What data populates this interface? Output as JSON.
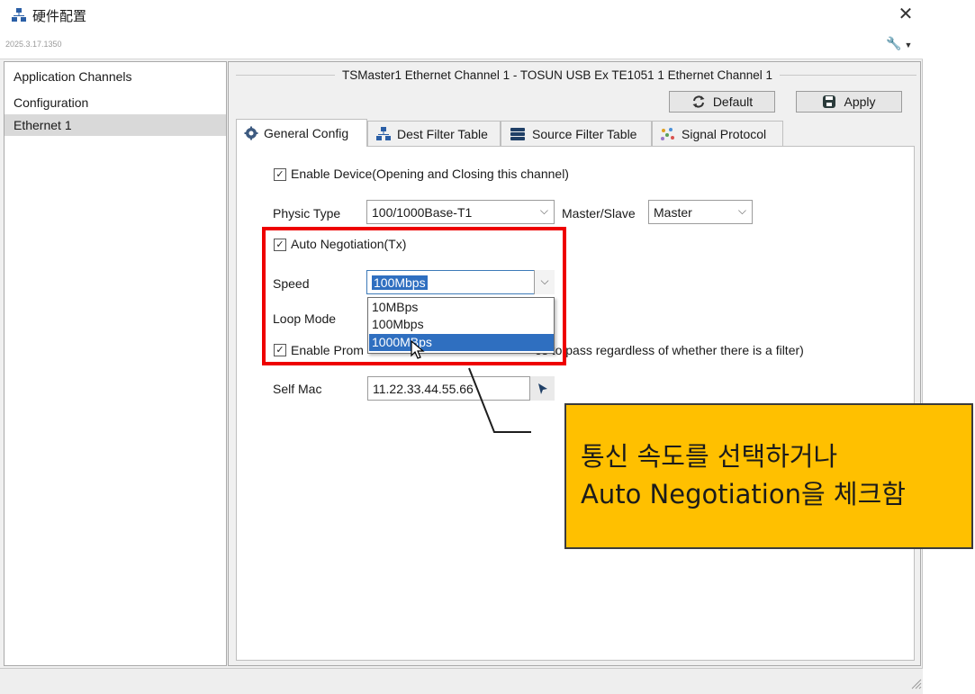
{
  "window": {
    "title": "硬件配置",
    "version": "2025.3.17.1350"
  },
  "tree": {
    "items": [
      "Application Channels",
      "Configuration",
      "Ethernet 1"
    ],
    "selected": "Ethernet 1"
  },
  "channel": {
    "title": "TSMaster1 Ethernet Channel 1 - TOSUN USB Ex TE1051 1 Ethernet Channel 1"
  },
  "toolbar": {
    "default_label": "Default",
    "apply_label": "Apply"
  },
  "tabs": [
    {
      "label": "General Config",
      "active": true
    },
    {
      "label": "Dest Filter Table",
      "active": false
    },
    {
      "label": "Source Filter Table",
      "active": false
    },
    {
      "label": "Signal Protocol",
      "active": false
    }
  ],
  "form": {
    "enable_device_label": "Enable Device(Opening and Closing this channel)",
    "enable_device_checked": true,
    "physic_type_label": "Physic Type",
    "physic_type_value": "100/1000Base-T1",
    "master_slave_label": "Master/Slave",
    "master_slave_value": "Master",
    "auto_negotiation_label": "Auto Negotiation(Tx)",
    "auto_negotiation_checked": true,
    "speed_label": "Speed",
    "speed_value": "100Mbps",
    "speed_options": [
      "10MBps",
      "100Mbps",
      "1000MBps"
    ],
    "speed_highlighted_option": "1000MBps",
    "loop_mode_label": "Loop Mode",
    "promiscuous_label_left": "Enable Prom",
    "promiscuous_label_right": "es to pass regardless of whether there is a filter)",
    "promiscuous_checked": true,
    "self_mac_label": "Self Mac",
    "self_mac_value": "11.22.33.44.55.66"
  },
  "annotation": {
    "line1": "통신 속도를 선택하거나",
    "line2": "Auto Negotiation을 체크함",
    "box_color": "#ee0000",
    "callout_color": "#ffc000"
  }
}
